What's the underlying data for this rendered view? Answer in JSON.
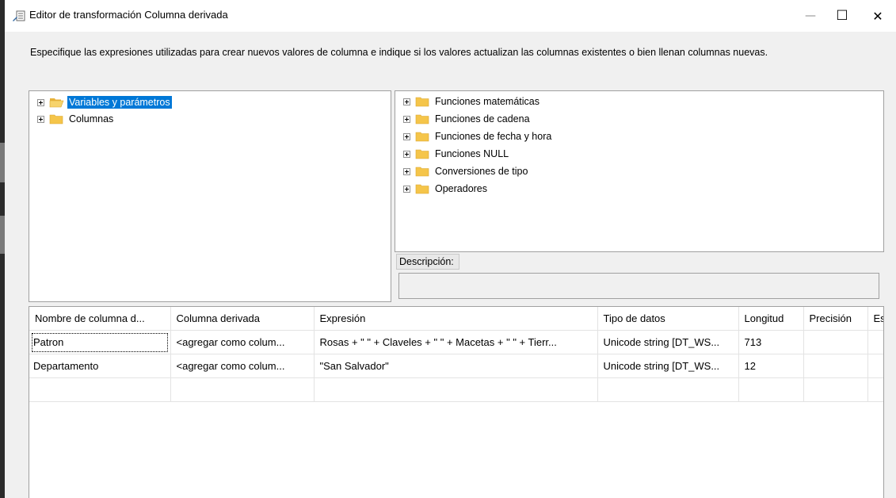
{
  "window": {
    "title": "Editor de transformación Columna derivada",
    "minimize_glyph": "—",
    "maximize_glyph": "☐",
    "close_glyph": "✕"
  },
  "instructions": "Especifique las expresiones utilizadas para crear nuevos valores de columna e indique si los valores actualizan las columnas existentes o bien llenan columnas nuevas.",
  "left_tree": {
    "items": [
      {
        "label": "Variables y parámetros",
        "icon": "open-folder-icon",
        "selected": true
      },
      {
        "label": "Columnas",
        "icon": "folder-icon",
        "selected": false
      }
    ]
  },
  "right_tree": {
    "items": [
      {
        "label": "Funciones matemáticas",
        "icon": "folder-icon"
      },
      {
        "label": "Funciones de cadena",
        "icon": "folder-icon"
      },
      {
        "label": "Funciones de fecha y hora",
        "icon": "folder-icon"
      },
      {
        "label": "Funciones NULL",
        "icon": "folder-icon"
      },
      {
        "label": "Conversiones de tipo",
        "icon": "folder-icon"
      },
      {
        "label": "Operadores",
        "icon": "folder-icon"
      }
    ]
  },
  "description": {
    "label": "Descripción:",
    "value": ""
  },
  "grid": {
    "columns": [
      "Nombre de columna d...",
      "Columna derivada",
      "Expresión",
      "Tipo de datos",
      "Longitud",
      "Precisión",
      "Es"
    ],
    "rows": [
      [
        "Patron",
        "<agregar como colum...",
        "Rosas + \" \" + Claveles + \" \" + Macetas + \" \" + Tierr...",
        "Unicode string [DT_WS...",
        "713",
        "",
        ""
      ],
      [
        "Departamento",
        "<agregar como colum...",
        "\"San Salvador\"",
        "Unicode string [DT_WS...",
        "12",
        "",
        ""
      ],
      [
        "",
        "",
        "",
        "",
        "",
        "",
        ""
      ]
    ]
  },
  "colors": {
    "selection": "#0078d7",
    "folder": "#f5c54a",
    "background": "#f0f0f0"
  }
}
